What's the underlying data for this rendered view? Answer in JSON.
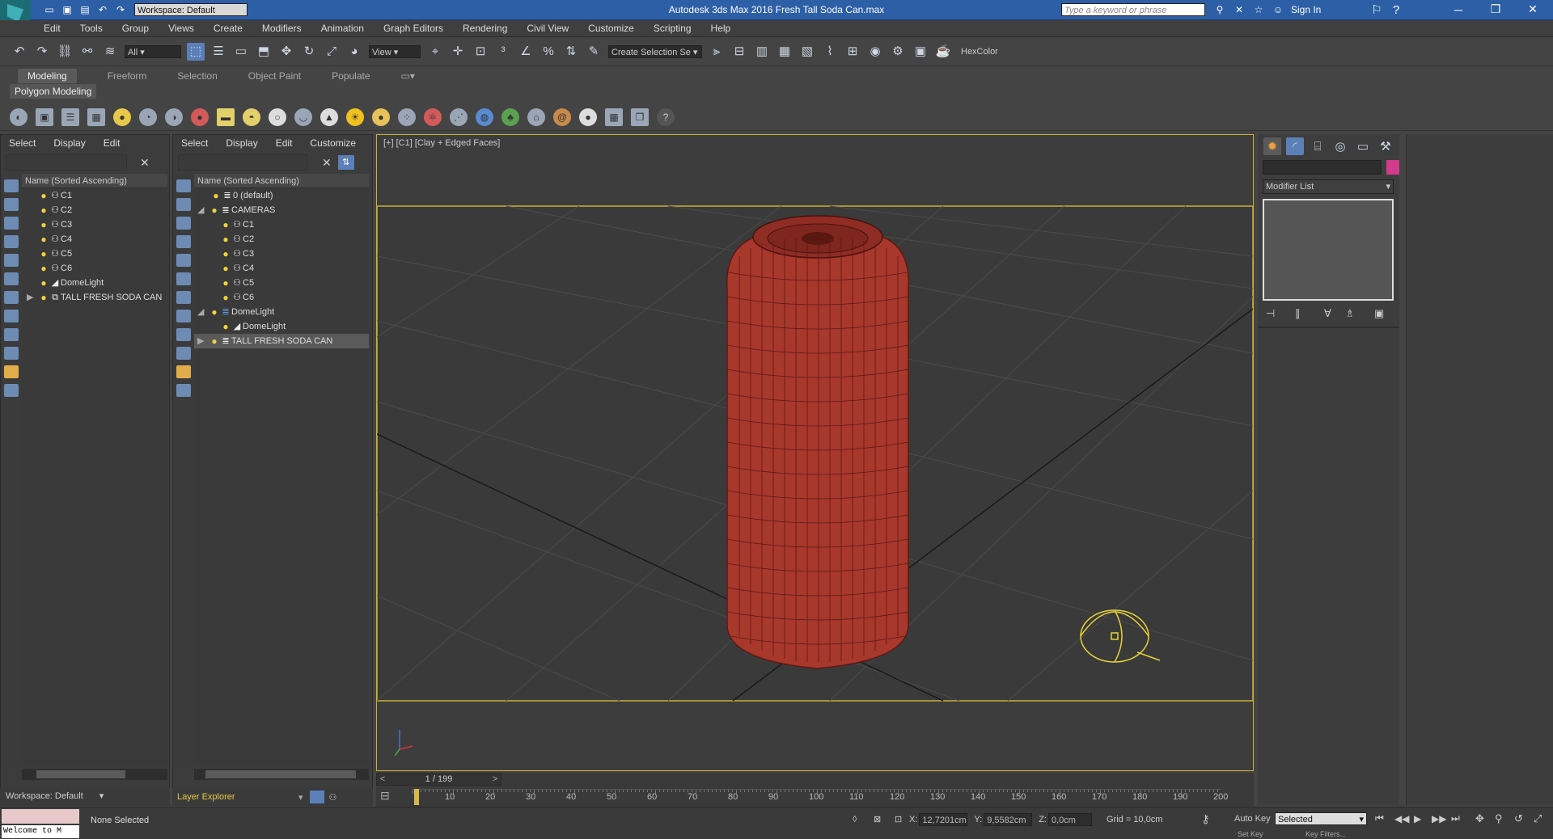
{
  "title_bar": {
    "workspace": "Workspace: Default",
    "title": "Autodesk 3ds Max 2016     Fresh Tall Soda Can.max",
    "search_placeholder": "Type a keyword or phrase",
    "sign_in": "Sign In"
  },
  "menu": [
    "Edit",
    "Tools",
    "Group",
    "Views",
    "Create",
    "Modifiers",
    "Animation",
    "Graph Editors",
    "Rendering",
    "Civil View",
    "Customize",
    "Scripting",
    "Help"
  ],
  "main_toolbar": {
    "selection_filter": "All",
    "ref_coord": "View",
    "named_selection": "Create Selection Se",
    "hexcolor": "HexColor"
  },
  "ribbon": {
    "tabs": [
      "Modeling",
      "Freeform",
      "Selection",
      "Object Paint",
      "Populate"
    ],
    "active_tab": "Modeling",
    "subpanel": "Polygon Modeling"
  },
  "scene_explorer_1": {
    "menu": [
      "Select",
      "Display",
      "Edit"
    ],
    "column_header": "Name (Sorted Ascending)",
    "items": [
      "C1",
      "C2",
      "C3",
      "C4",
      "C5",
      "C6",
      "DomeLight",
      "TALL FRESH SODA CAN"
    ]
  },
  "scene_explorer_2": {
    "menu": [
      "Select",
      "Display",
      "Edit",
      "Customize"
    ],
    "column_header": "Name (Sorted Ascending)",
    "items": [
      {
        "label": "0 (default)",
        "depth": 1,
        "icon": "layer"
      },
      {
        "label": "CAMERAS",
        "depth": 0,
        "icon": "layer",
        "expanded": true
      },
      {
        "label": "C1",
        "depth": 1,
        "icon": "camera"
      },
      {
        "label": "C2",
        "depth": 1,
        "icon": "camera"
      },
      {
        "label": "C3",
        "depth": 1,
        "icon": "camera"
      },
      {
        "label": "C4",
        "depth": 1,
        "icon": "camera"
      },
      {
        "label": "C5",
        "depth": 1,
        "icon": "camera"
      },
      {
        "label": "C6",
        "depth": 1,
        "icon": "camera"
      },
      {
        "label": "DomeLight",
        "depth": 0,
        "icon": "layer",
        "expanded": true
      },
      {
        "label": "DomeLight",
        "depth": 1,
        "icon": "light"
      },
      {
        "label": "TALL FRESH SODA CAN",
        "depth": 0,
        "icon": "layer",
        "selected": true
      }
    ],
    "footer_label": "Layer Explorer"
  },
  "viewport": {
    "label": "[+] [C1] [Clay + Edged Faces]"
  },
  "command_panel": {
    "modifier_list": "Modifier List"
  },
  "timeline": {
    "frame": "1 / 199",
    "ticks": [
      "10",
      "20",
      "30",
      "40",
      "50",
      "60",
      "70",
      "80",
      "90",
      "100",
      "110",
      "120",
      "130",
      "140",
      "150",
      "160",
      "170",
      "180",
      "190",
      "200"
    ]
  },
  "status": {
    "workspace": "Workspace: Default",
    "selection": "None Selected",
    "maxscript": "Welcome to M",
    "x_label": "X:",
    "x": "12,7201cm",
    "y_label": "Y:",
    "y": "9,5582cm",
    "z_label": "Z:",
    "z": "0,0cm",
    "grid": "Grid = 10,0cm",
    "auto_key": "Auto Key",
    "key_mode": "Selected",
    "set_key": "Set Key",
    "key_filters": "Key Filters..."
  },
  "colors": {
    "title_bar": "#2d5fa6",
    "viewport_border": "#c7b23a",
    "can": "#a8372c",
    "selection_color": "#d23a8c"
  }
}
